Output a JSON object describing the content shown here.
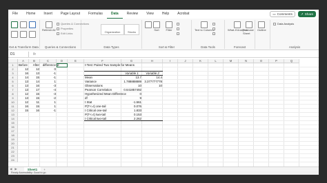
{
  "menu": {
    "items": [
      "File",
      "Home",
      "Insert",
      "Page Layout",
      "Formulas",
      "Data",
      "Review",
      "View",
      "Help",
      "Acrobat"
    ],
    "active": "Data",
    "comments_label": "Comments",
    "share_label": "Share"
  },
  "ribbon": {
    "get_data_group": "Get & Transform Data",
    "queries_group": "Queries & Connections",
    "data_types_group": "Data Types",
    "sort_filter_group": "Sort & Filter",
    "data_tools_group": "Data Tools",
    "forecast_group": "Forecast",
    "outline_label": "Outline",
    "analysis_group": "Analysis",
    "data_analysis_label": "Data Analysis",
    "refresh_label": "Refresh All",
    "queries_item": "Queries & Connections",
    "properties_item": "Properties",
    "edit_links_item": "Edit Links",
    "organization_label": "Organization",
    "stocks_label": "Stocks",
    "sort_label": "Sort",
    "filter_label": "Filter",
    "text_to_columns_label": "Text to Columns",
    "what_if_label": "What-If Analysis",
    "forecast_sheet_label": "Forecast Sheet"
  },
  "formula_bar": {
    "name_box": "D1",
    "fx": "fx",
    "value": ""
  },
  "columns": [
    "A",
    "B",
    "C",
    "D",
    "E",
    "F",
    "G",
    "H",
    "I",
    "J",
    "K",
    "L",
    "M",
    "N",
    "O",
    "P",
    "Q"
  ],
  "rows": [
    "1",
    "2",
    "3",
    "4",
    "5",
    "6",
    "7",
    "8",
    "9",
    "10",
    "11",
    "12",
    "13",
    "14",
    "15",
    "16",
    "17",
    "18",
    "19",
    "20",
    "21",
    "22",
    "23",
    "24"
  ],
  "data_table": {
    "headers": [
      "Before",
      "After",
      "difference",
      "d"
    ],
    "before": [
      "12",
      "16",
      "14",
      "13",
      "13",
      "13",
      "12",
      "13",
      "12",
      "16",
      "15"
    ],
    "after": [
      "12",
      "13",
      "15",
      "14",
      "16",
      "17",
      "15",
      "15",
      "11",
      "15",
      "16"
    ],
    "difference": [
      "0",
      "-1",
      "-1",
      "1",
      "-3",
      "-4",
      "-3",
      "-2",
      "1",
      "1",
      "-1"
    ]
  },
  "ttest": {
    "title": "t-Test: Paired Two Sample for Means",
    "var1_header": "Variable 1",
    "var2_header": "Variable 2",
    "rows": [
      {
        "label": "Mean",
        "v1": "13.7",
        "v2": "14.4"
      },
      {
        "label": "Variance",
        "v1": "1.788888889",
        "v2": "3.377777778"
      },
      {
        "label": "Observations",
        "v1": "10",
        "v2": "10"
      },
      {
        "label": "Pearson Correlation",
        "v1": "0.641857492",
        "v2": ""
      },
      {
        "label": "Hypothesized Mean Difference",
        "v1": "0",
        "v2": ""
      },
      {
        "label": "df",
        "v1": "9",
        "v2": ""
      },
      {
        "label": "t Stat",
        "v1": "-1.561",
        "v2": ""
      },
      {
        "label": "P(T<=t) one-tail",
        "v1": "0.076",
        "v2": ""
      },
      {
        "label": "t Critical one-tail",
        "v1": "1.833",
        "v2": ""
      },
      {
        "label": "P(T<=t) two-tail",
        "v1": "0.153",
        "v2": ""
      },
      {
        "label": "t Critical two-tail",
        "v1": "2.262",
        "v2": ""
      }
    ]
  },
  "sheet_tab": "Sheet1",
  "add_sheet": "+",
  "status": "Ready    Accessibility: Good to go",
  "colors": {
    "accent": "#217346",
    "ribbon_bg": "#f7f7f7",
    "frame": "#2b2b2b"
  }
}
